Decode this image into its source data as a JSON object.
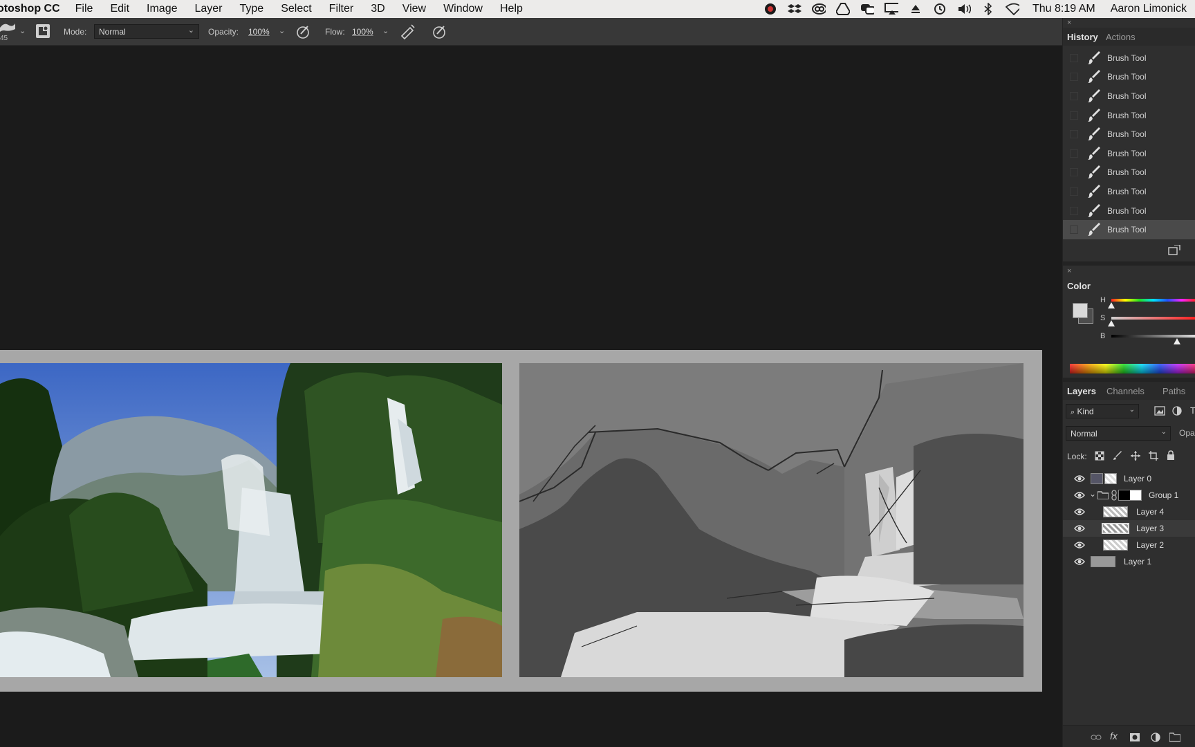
{
  "menubar": {
    "app_name": "otoshop CC",
    "items": [
      "File",
      "Edit",
      "Image",
      "Layer",
      "Type",
      "Select",
      "Filter",
      "3D",
      "View",
      "Window",
      "Help"
    ],
    "clock": "Thu 8:19 AM",
    "user": "Aaron Limonick"
  },
  "options": {
    "brush_size": "45",
    "mode_label": "Mode:",
    "mode_value": "Normal",
    "opacity_label": "Opacity:",
    "opacity_value": "100%",
    "flow_label": "Flow:",
    "flow_value": "100%"
  },
  "history": {
    "tabs": [
      "History",
      "Actions"
    ],
    "items": [
      "Brush Tool",
      "Brush Tool",
      "Brush Tool",
      "Brush Tool",
      "Brush Tool",
      "Brush Tool",
      "Brush Tool",
      "Brush Tool",
      "Brush Tool",
      "Brush Tool"
    ]
  },
  "color": {
    "title": "Color",
    "h_label": "H",
    "s_label": "S",
    "b_label": "B",
    "foreground": "#d9d9d9",
    "background": "#4d4d4d"
  },
  "layers": {
    "tabs": [
      "Layers",
      "Channels",
      "Paths"
    ],
    "filter_kind": "Kind",
    "blend_mode": "Normal",
    "opacity_label": "Opa",
    "lock_label": "Lock:",
    "items": [
      {
        "name": "Layer 0"
      },
      {
        "name": "Group 1"
      },
      {
        "name": "Layer 4"
      },
      {
        "name": "Layer 3"
      },
      {
        "name": "Layer 2"
      },
      {
        "name": "Layer 1"
      }
    ]
  }
}
